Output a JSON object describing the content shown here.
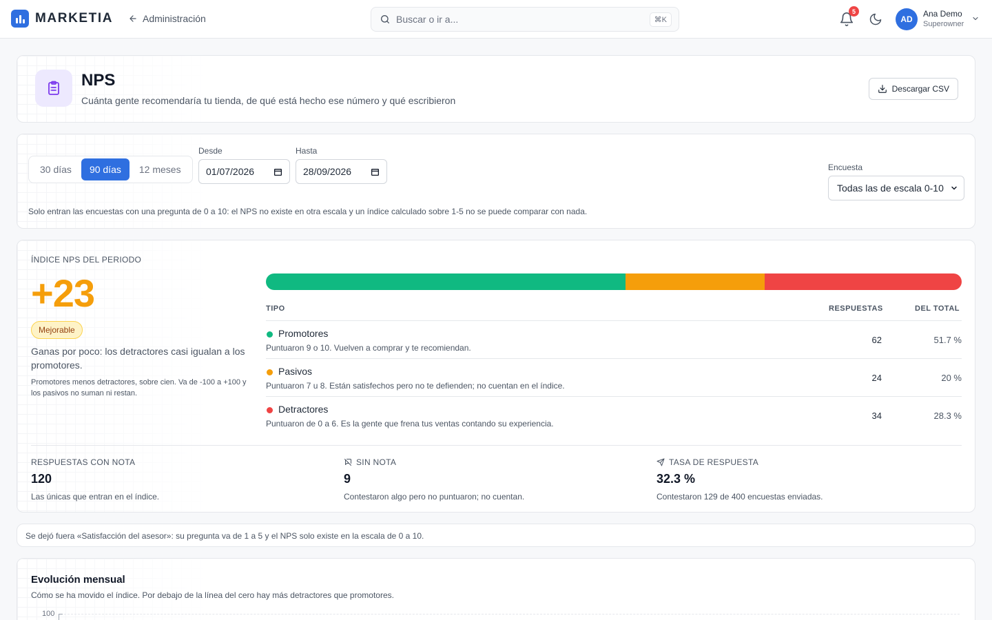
{
  "app": {
    "logo_text": "MARKETIA",
    "back_label": "Administración",
    "search_placeholder": "Buscar o ir a...",
    "search_shortcut": "⌘K",
    "notifications_count": "5",
    "user": {
      "initials": "AD",
      "name": "Ana Demo",
      "role": "Superowner"
    },
    "brand_color": "#2f6fe0"
  },
  "header": {
    "title": "NPS",
    "subtitle": "Cuánta gente recomendaría tu tienda, de qué está hecho ese número y qué escribieron",
    "csv_button": "Descargar CSV",
    "icon": "clipboard-list-icon"
  },
  "filters": {
    "periods": [
      "30 días",
      "90 días",
      "12 meses"
    ],
    "active_period": "90 días",
    "from_label": "Desde",
    "from_value": "01/07/2026",
    "to_label": "Hasta",
    "to_value": "28/09/2026",
    "survey_label": "Encuesta",
    "survey_value": "Todas las de escala 0-10",
    "note": "Solo entran las encuestas con una pregunta de 0 a 10: el NPS no existe en otra escala y un índice calculado sobre 1-5 no se puede comparar con nada."
  },
  "nps": {
    "label": "ÍNDICE NPS DEL PERIODO",
    "value": "+23",
    "badge": "Mejorable",
    "description": "Ganas por poco: los detractores casi igualan a los promotores.",
    "footnote": "Promotores menos detractores, sobre cien. Va de -100 a +100 y los pasivos no suman ni restan.",
    "table_headers": {
      "type": "TIPO",
      "responses": "RESPUESTAS",
      "share": "DEL TOTAL"
    },
    "rows": [
      {
        "title": "Promotores",
        "desc": "Puntuaron 9 o 10. Vuelven a comprar y te recomiendan.",
        "count": "62",
        "pct": "51.7 %",
        "color": "#10b981",
        "fraction": 0.517
      },
      {
        "title": "Pasivos",
        "desc": "Puntuaron 7 u 8. Están satisfechos pero no te defienden; no cuentan en el índice.",
        "count": "24",
        "pct": "20 %",
        "color": "#f59e0b",
        "fraction": 0.2
      },
      {
        "title": "Detractores",
        "desc": "Puntuaron de 0 a 6. Es la gente que frena tus ventas contando su experiencia.",
        "count": "34",
        "pct": "28.3 %",
        "color": "#ef4444",
        "fraction": 0.283
      }
    ],
    "kpis": [
      {
        "label": "RESPUESTAS CON NOTA",
        "value": "120",
        "note": "Las únicas que entran en el índice.",
        "icon": ""
      },
      {
        "label": "SIN NOTA",
        "value": "9",
        "note": "Contestaron algo pero no puntuaron; no cuentan.",
        "icon": "message-off-icon"
      },
      {
        "label": "TASA DE RESPUESTA",
        "value": "32.3 %",
        "note": "Contestaron 129 de 400 encuestas enviadas.",
        "icon": "send-icon"
      }
    ]
  },
  "notice": "Se dejó fuera «Satisfacción del asesor»: su pregunta va de 1 a 5 y el NPS solo existe en la escala de 0 a 10.",
  "evolution": {
    "title": "Evolución mensual",
    "subtitle": "Cómo se ha movido el índice. Por debajo de la línea del cero hay más detractores que promotores.",
    "y_tick_top": "100"
  }
}
